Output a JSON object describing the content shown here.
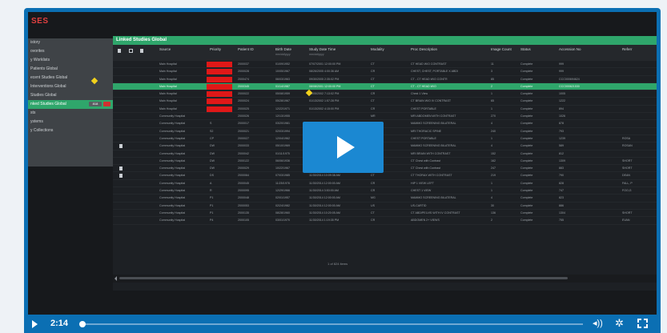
{
  "app": {
    "logo_text": "SE",
    "logo_mark": "S"
  },
  "sidebar": {
    "items": [
      {
        "label": "istory",
        "active": false
      },
      {
        "label": "ovorites",
        "active": false
      },
      {
        "label": "y Worklists",
        "active": false
      },
      {
        "label": "Patients Global",
        "active": false
      },
      {
        "label": "ecent Studies Global",
        "active": false
      },
      {
        "label": "Interventions Global",
        "active": false
      },
      {
        "label": "Studies Global",
        "active": false
      },
      {
        "label": "nked Studies Global",
        "active": true,
        "badge": "818"
      },
      {
        "label": "sts",
        "active": false
      },
      {
        "label": "ystems",
        "active": false
      },
      {
        "label": "y Collections",
        "active": false
      }
    ]
  },
  "panel": {
    "title": "Linked Studies Global",
    "columns": [
      {
        "label": "Source"
      },
      {
        "label": "Priority"
      },
      {
        "label": "Patient ID"
      },
      {
        "label": "Birth Date",
        "sub": "mm/dd/yyyy"
      },
      {
        "label": "Study Date Time",
        "sub": "mm/dd/yyyy"
      },
      {
        "label": "Modality"
      },
      {
        "label": "Proc Description"
      },
      {
        "label": "Image Count"
      },
      {
        "label": "Status"
      },
      {
        "label": "Accession No"
      },
      {
        "label": "Referr"
      }
    ],
    "footer_text": "1 of 824 items"
  },
  "rows": [
    {
      "source": "Main Hospital",
      "priority": "",
      "pid": "2000037",
      "dob": "01/09/1952",
      "date": "07/07/2001 12:00:00 PM",
      "mod": "CT",
      "desc": "CT HEAD W/O CONTRAST",
      "count": "11",
      "status": "Complete",
      "acc": "999",
      "ref": "",
      "red": true,
      "sel": false
    },
    {
      "source": "Main Hospital",
      "priority": "",
      "pid": "2000028",
      "dob": "10/05/1967",
      "date": "08/26/2005 4:00:36 AM",
      "mod": "CR",
      "desc": "CHEST, CHEST, PORTABLE X ABDI",
      "count": "3",
      "status": "Complete",
      "acc": "999",
      "ref": "",
      "red": true,
      "sel": false
    },
    {
      "source": "Main Hospital",
      "priority": "",
      "pid": "2000474",
      "dob": "06/03/1963",
      "date": "09/30/2005 2:35:02 PM",
      "mod": "CT",
      "desc": "CT - CT HEAD W/O CONTR",
      "count": "85",
      "status": "Complete",
      "acc": "CCC000694624",
      "ref": "",
      "red": true,
      "sel": false
    },
    {
      "source": "Main Hospital",
      "priority": "",
      "pid": "2000345",
      "dob": "01/14/1987",
      "date": "08/08/2001 12:00:00 PM",
      "mod": "CT",
      "desc": "CT - CT HEAD W/O",
      "count": "2",
      "status": "Complete",
      "acc": "CCC000621530",
      "ref": "",
      "red": true,
      "sel": true
    },
    {
      "source": "Main Hospital",
      "priority": "",
      "pid": "2000022",
      "dob": "05/08/1959",
      "date": "09/05/2002 7:13:02 PM",
      "mod": "CR",
      "desc": "Chest 1 View",
      "count": "1",
      "status": "Complete",
      "acc": "1005",
      "ref": "",
      "red": true,
      "sel": false
    },
    {
      "source": "Main Hospital",
      "priority": "",
      "pid": "2000024",
      "dob": "05/28/1967",
      "date": "01/13/2002 1:57:28 PM",
      "mod": "CT",
      "desc": "CT BRAIN W/O IV CONTRAST",
      "count": "65",
      "status": "Complete",
      "acc": "1222",
      "ref": "",
      "red": true,
      "sel": false
    },
    {
      "source": "Main Hospital",
      "priority": "",
      "pid": "2000025",
      "dob": "12/22/1971",
      "date": "01/13/2002 4:15:00 PM",
      "mod": "CR",
      "desc": "CHEST PORTABLE",
      "count": "1",
      "status": "Complete",
      "acc": "894",
      "ref": "",
      "red": true,
      "sel": false
    },
    {
      "source": "Community Hospital",
      "priority": "",
      "pid": "2000026",
      "dob": "12/13/1955",
      "date": "",
      "mod": "MR",
      "desc": "MRI ABDOMEN WITH CONTRAST",
      "count": "270",
      "status": "Complete",
      "acc": "1026",
      "ref": "",
      "red": false,
      "sel": false
    },
    {
      "source": "Community Hospital",
      "priority": "S",
      "pid": "2000017",
      "dob": "03/20/1981",
      "date": "",
      "mod": "MG",
      "desc": "MAMMO SCREENING BILATERAL",
      "count": "4",
      "status": "Complete",
      "acc": "878",
      "ref": "",
      "red": false,
      "sel": false
    },
    {
      "source": "Community Hospital",
      "priority": "S2",
      "pid": "2000021",
      "dob": "02/03/1994",
      "date": "",
      "mod": "MR",
      "desc": "MRI THORACIC SPINE",
      "count": "240",
      "status": "Complete",
      "acc": "793",
      "ref": "",
      "red": false,
      "sel": false
    },
    {
      "source": "Community Hospital",
      "priority": "CP",
      "pid": "2000027",
      "dob": "12/04/1962",
      "date": "",
      "mod": "CR",
      "desc": "CHEST PORTABLE",
      "count": "1",
      "status": "Complete",
      "acc": "1239",
      "ref": "ROSA",
      "red": false,
      "sel": false
    },
    {
      "source": "Community Hospital",
      "priority": "DW",
      "pid": "2000033",
      "dob": "05/10/1969",
      "date": "11/30/2014 12:00:00 AM",
      "mod": "MG",
      "desc": "MAMMO SCREENING BILATERAL",
      "count": "4",
      "status": "Complete",
      "acc": "589",
      "ref": "ROSAN",
      "red": false,
      "sel": false
    },
    {
      "source": "Community Hospital",
      "priority": "DW",
      "pid": "2000042",
      "dob": "01/11/1975",
      "date": "11/30/2014 6:25:11 AM",
      "mod": "MR",
      "desc": "MRI BRAIN WITH CONTRAST",
      "count": "152",
      "status": "Complete",
      "acc": "812",
      "ref": "",
      "red": false,
      "sel": false
    },
    {
      "source": "Community Hospital",
      "priority": "DW",
      "pid": "2000122",
      "dob": "06/06/1936",
      "date": "11/30/2014 10:53:38 AM",
      "mod": "CT",
      "desc": "CT Chest with Contrast",
      "count": "162",
      "status": "Complete",
      "acc": "1309",
      "ref": "SHORT",
      "red": false,
      "sel": false
    },
    {
      "source": "Community Hospital",
      "priority": "DW",
      "pid": "2000029",
      "dob": "10/22/1967",
      "date": "11/30/2014 12:12:05 AM",
      "mod": "CT",
      "desc": "CT Chest with Contrast",
      "count": "247",
      "status": "Complete",
      "acc": "883",
      "ref": "SHORT",
      "red": false,
      "sel": false
    },
    {
      "source": "Community Hospital",
      "priority": "DS",
      "pid": "2000064",
      "dob": "07/03/1985",
      "date": "11/30/2014 10:09:38 AM",
      "mod": "CT",
      "desc": "CT THORAX WITH CONTRAST",
      "count": "219",
      "status": "Complete",
      "acc": "790",
      "ref": "DEAN",
      "red": false,
      "sel": false
    },
    {
      "source": "Community Hospital",
      "priority": "A",
      "pid": "2000045",
      "dob": "11/25/1978",
      "date": "11/30/2014 12:00:00 AM",
      "mod": "CR",
      "desc": "HIP 1 VIEW LEFT",
      "count": "1",
      "status": "Complete",
      "acc": "828",
      "ref": "FALL, P",
      "red": false,
      "sel": false
    },
    {
      "source": "Community Hospital",
      "priority": "R",
      "pid": "2000095",
      "dob": "12/29/1966",
      "date": "11/30/2014 3:53:00 AM",
      "mod": "CR",
      "desc": "CHEST 1 VIEW",
      "count": "1",
      "status": "Complete",
      "acc": "747",
      "ref": "FOO,G",
      "red": false,
      "sel": false
    },
    {
      "source": "Community Hospital",
      "priority": "P1",
      "pid": "2000048",
      "dob": "02/01/1957",
      "date": "11/30/2014 12:00:00 AM",
      "mod": "MG",
      "desc": "MAMMO SCREENING BILATERAL",
      "count": "4",
      "status": "Complete",
      "acc": "823",
      "ref": "",
      "red": false,
      "sel": false
    },
    {
      "source": "Community Hospital",
      "priority": "P1",
      "pid": "2000053",
      "dob": "02/24/1982",
      "date": "11/30/2014 12:00:00 AM",
      "mod": "US",
      "desc": "US-CARTID",
      "count": "30",
      "status": "Complete",
      "acc": "886",
      "ref": "",
      "red": false,
      "sel": false
    },
    {
      "source": "Community Hospital",
      "priority": "P1",
      "pid": "2000135",
      "dob": "08/28/1960",
      "date": "11/30/2014 10:20:05 AM",
      "mod": "CT",
      "desc": "CT ABD/PELVIS WITH IV CONTRAST",
      "count": "136",
      "status": "Complete",
      "acc": "1304",
      "ref": "SHORT",
      "red": false,
      "sel": false
    },
    {
      "source": "Community Hospital",
      "priority": "P4",
      "pid": "2000105",
      "dob": "03/01/1970",
      "date": "11/30/2014 1:19:35 PM",
      "mod": "CR",
      "desc": "ABDOMEN 2+ VIEWS",
      "count": "2",
      "status": "Complete",
      "acc": "755",
      "ref": "EVAN",
      "red": false,
      "sel": false
    }
  ],
  "player": {
    "time": "2:14",
    "progress": 0.004
  }
}
